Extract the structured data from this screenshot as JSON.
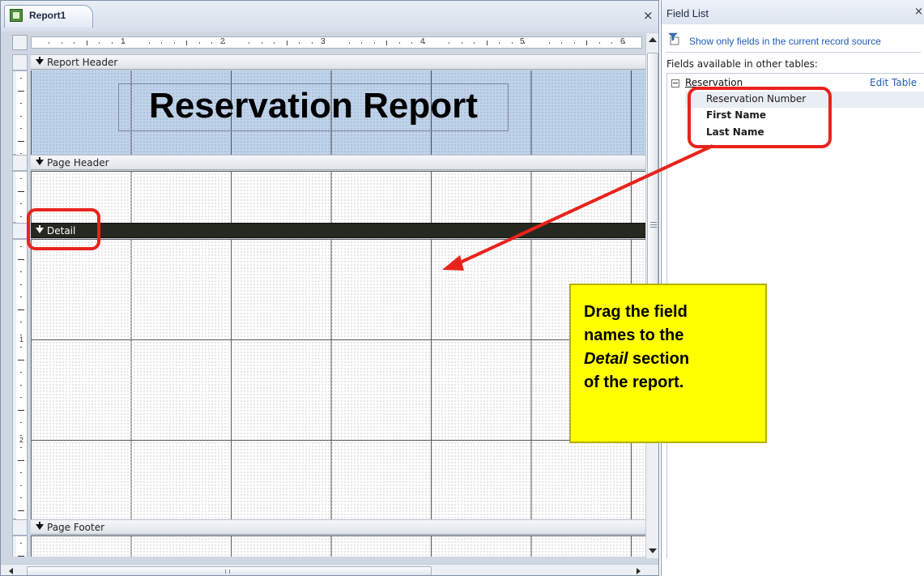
{
  "report_window": {
    "tab_title": "Report1",
    "close_glyph": "×"
  },
  "ruler": {
    "numbers": [
      "1",
      "2",
      "3",
      "4",
      "5",
      "6"
    ],
    "vertical_numbers": [
      "1",
      "2"
    ]
  },
  "sections": {
    "report_header": "Report Header",
    "page_header": "Page Header",
    "detail": "Detail",
    "page_footer": "Page Footer",
    "report_title": "Reservation Report"
  },
  "field_list": {
    "title": "Field List",
    "close_glyph": "×",
    "show_only_link": "Show only fields in the current record source",
    "other_tables_label": "Fields available in other tables:",
    "table_name": "Reservation",
    "edit_table_link": "Edit Table",
    "fields": [
      "Reservation Number",
      "First Name",
      "Last Name"
    ]
  },
  "annotation": {
    "line1": "Drag the field",
    "line2": "names to the",
    "line3_em": "Detail",
    "line3_rest": " section",
    "line4": "of the report."
  },
  "colors": {
    "highlight_red": "#e8231c",
    "callout_yellow": "#ffff00",
    "header_blue": "#bfd3ea",
    "detail_band": "#26291f"
  },
  "icons": [
    "report-icon",
    "close-icon",
    "scroll-up-icon",
    "scroll-down-icon",
    "scroll-left-icon",
    "scroll-right-icon",
    "filter-fields-icon",
    "collapse-icon",
    "band-arrow-icon"
  ]
}
